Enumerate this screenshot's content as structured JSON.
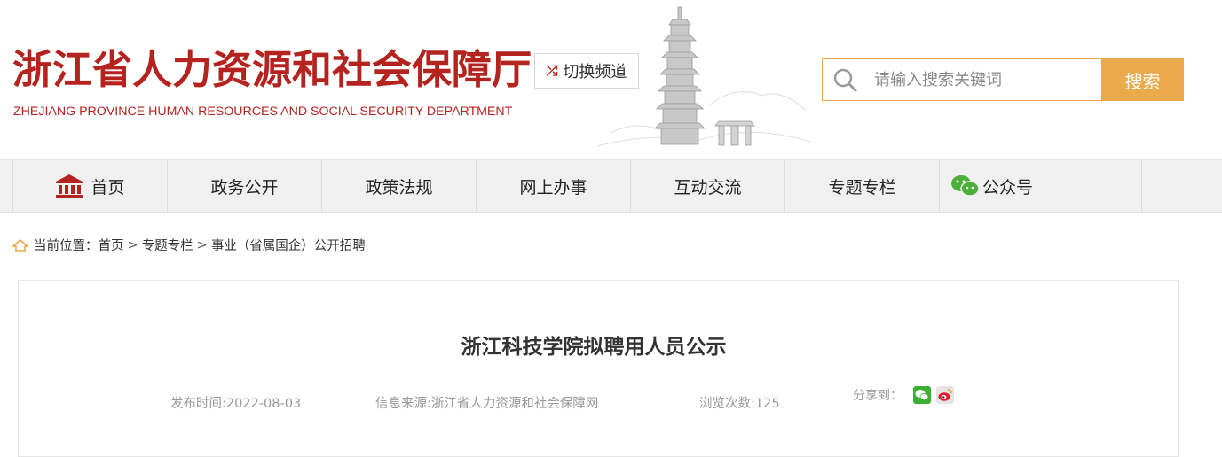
{
  "header": {
    "title_cn": "浙江省人力资源和社会保障厅",
    "title_en": "ZHEJIANG PROVINCE HUMAN RESOURCES AND SOCIAL SECURITY DEPARTMENT",
    "switch_channel": "切换频道"
  },
  "search": {
    "placeholder": "请输入搜索关键词",
    "button": "搜索"
  },
  "nav": {
    "items": [
      {
        "label": "首页",
        "icon": "bank-icon"
      },
      {
        "label": "政务公开"
      },
      {
        "label": "政策法规"
      },
      {
        "label": "网上办事"
      },
      {
        "label": "互动交流"
      },
      {
        "label": "专题专栏"
      },
      {
        "label": "公众号",
        "icon": "wechat-icon"
      }
    ]
  },
  "breadcrumb": {
    "prefix": "当前位置：",
    "items": [
      "首页",
      "专题专栏",
      "事业（省属国企）公开招聘"
    ],
    "separator": ">"
  },
  "article": {
    "title": "浙江科技学院拟聘用人员公示",
    "publish_time": "发布时间:2022-08-03",
    "source": "信息来源:浙江省人力资源和社会保障网",
    "views": "浏览次数:125",
    "share_label": "分享到："
  },
  "colors": {
    "brand_red": "#b5231f",
    "search_accent": "#eaa94a"
  }
}
